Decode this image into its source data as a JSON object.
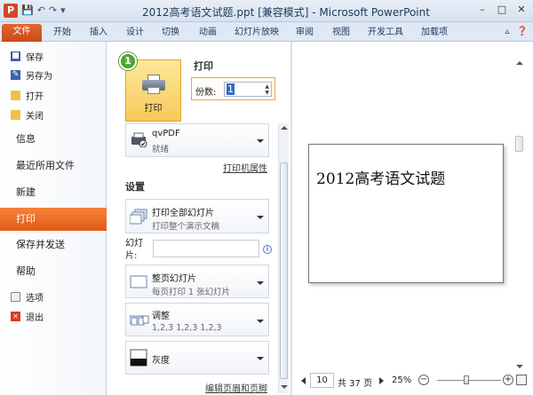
{
  "window": {
    "title": "2012高考语文试题.ppt [兼容模式] - Microsoft PowerPoint",
    "app_icon": "P",
    "qat": [
      "save-icon",
      "undo-icon",
      "redo-icon"
    ]
  },
  "ribbon": {
    "tabs": [
      "文件",
      "开始",
      "插入",
      "设计",
      "切换",
      "动画",
      "幻灯片放映",
      "审阅",
      "视图",
      "开发工具",
      "加载项"
    ]
  },
  "nav": {
    "small_items": [
      {
        "label": "保存",
        "icon": "save-icon"
      },
      {
        "label": "另存为",
        "icon": "save-as-icon"
      },
      {
        "label": "打开",
        "icon": "folder-open-icon"
      },
      {
        "label": "关闭",
        "icon": "close-file-icon"
      }
    ],
    "big_items": [
      "信息",
      "最近所用文件",
      "新建",
      "打印",
      "保存并发送",
      "帮助"
    ],
    "active": "打印",
    "bottom_items": [
      {
        "label": "选项",
        "icon": "options-icon"
      },
      {
        "label": "退出",
        "icon": "exit-icon"
      }
    ]
  },
  "print": {
    "badge": "1",
    "button_label": "打印",
    "section_title": "打印",
    "copies_label": "份数:",
    "copies_value": "1",
    "printer_name": "qvPDF",
    "printer_status": "就绪",
    "printer_props_link": "打印机属性",
    "settings_title": "设置",
    "range_title": "打印全部幻灯片",
    "range_sub": "打印整个演示文稿",
    "slides_label": "幻灯\n片:",
    "layout_title": "整页幻灯片",
    "layout_sub": "每页打印 1 张幻灯片",
    "collate_title": "调整",
    "collate_sub": "1,2,3    1,2,3    1,2,3",
    "color_title": "灰度",
    "header_footer_link": "编辑页眉和页脚"
  },
  "preview": {
    "slide_title": "2012高考语文试题",
    "current_page": "10",
    "total_pages": "共 37 页",
    "zoom": "25%"
  }
}
